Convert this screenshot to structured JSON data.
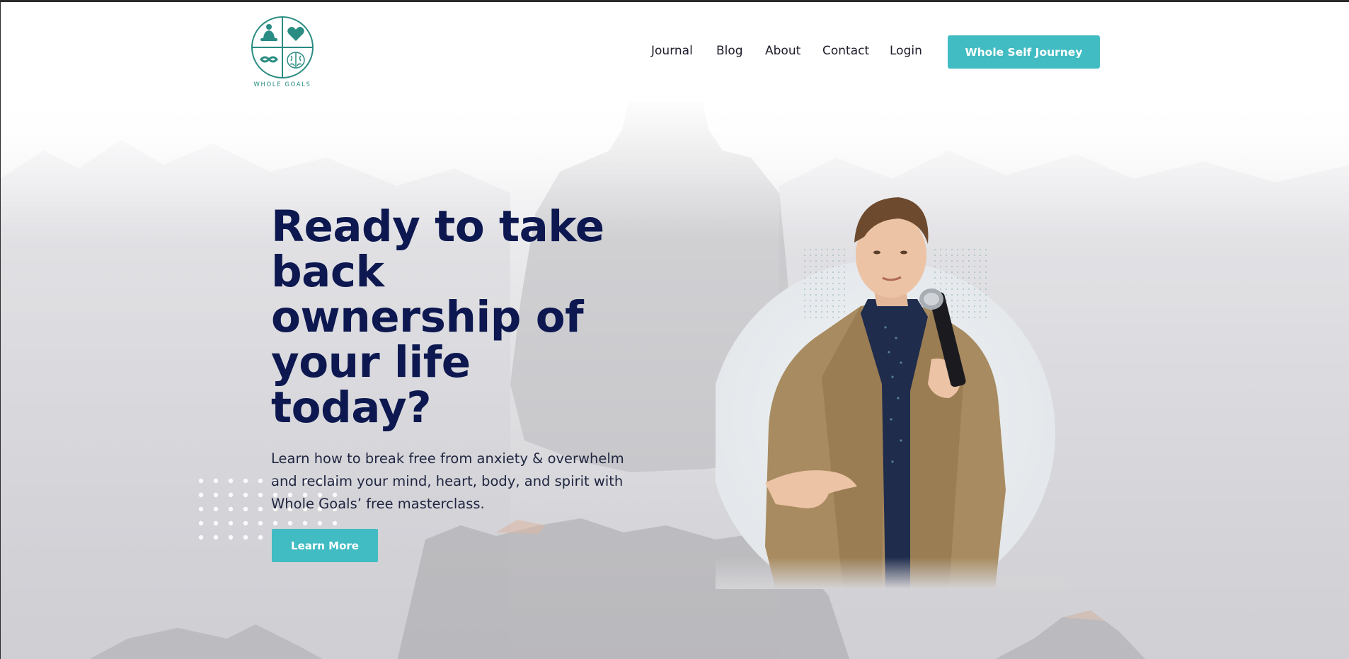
{
  "brand": {
    "name": "WHOLE GOALS",
    "color": "#2a8c82"
  },
  "nav": {
    "items": [
      {
        "label": "Journal"
      },
      {
        "label": "Blog"
      },
      {
        "label": "About"
      },
      {
        "label": "Contact"
      },
      {
        "label": "Login"
      }
    ],
    "cta_label": "Whole Self Journey"
  },
  "hero": {
    "headline": "Ready to take back ownership of your life today?",
    "subtext": "Learn how to break free from anxiety & overwhelm and reclaim your mind, heart, body, and spirit with Whole Goals’ free masterclass.",
    "button_label": "Learn More"
  },
  "colors": {
    "accent": "#41bcc3",
    "headline": "#0d1850",
    "body_text": "#1f2540"
  },
  "icons": [
    "meditation-icon",
    "heart-icon",
    "infinity-icon",
    "brain-icon"
  ]
}
